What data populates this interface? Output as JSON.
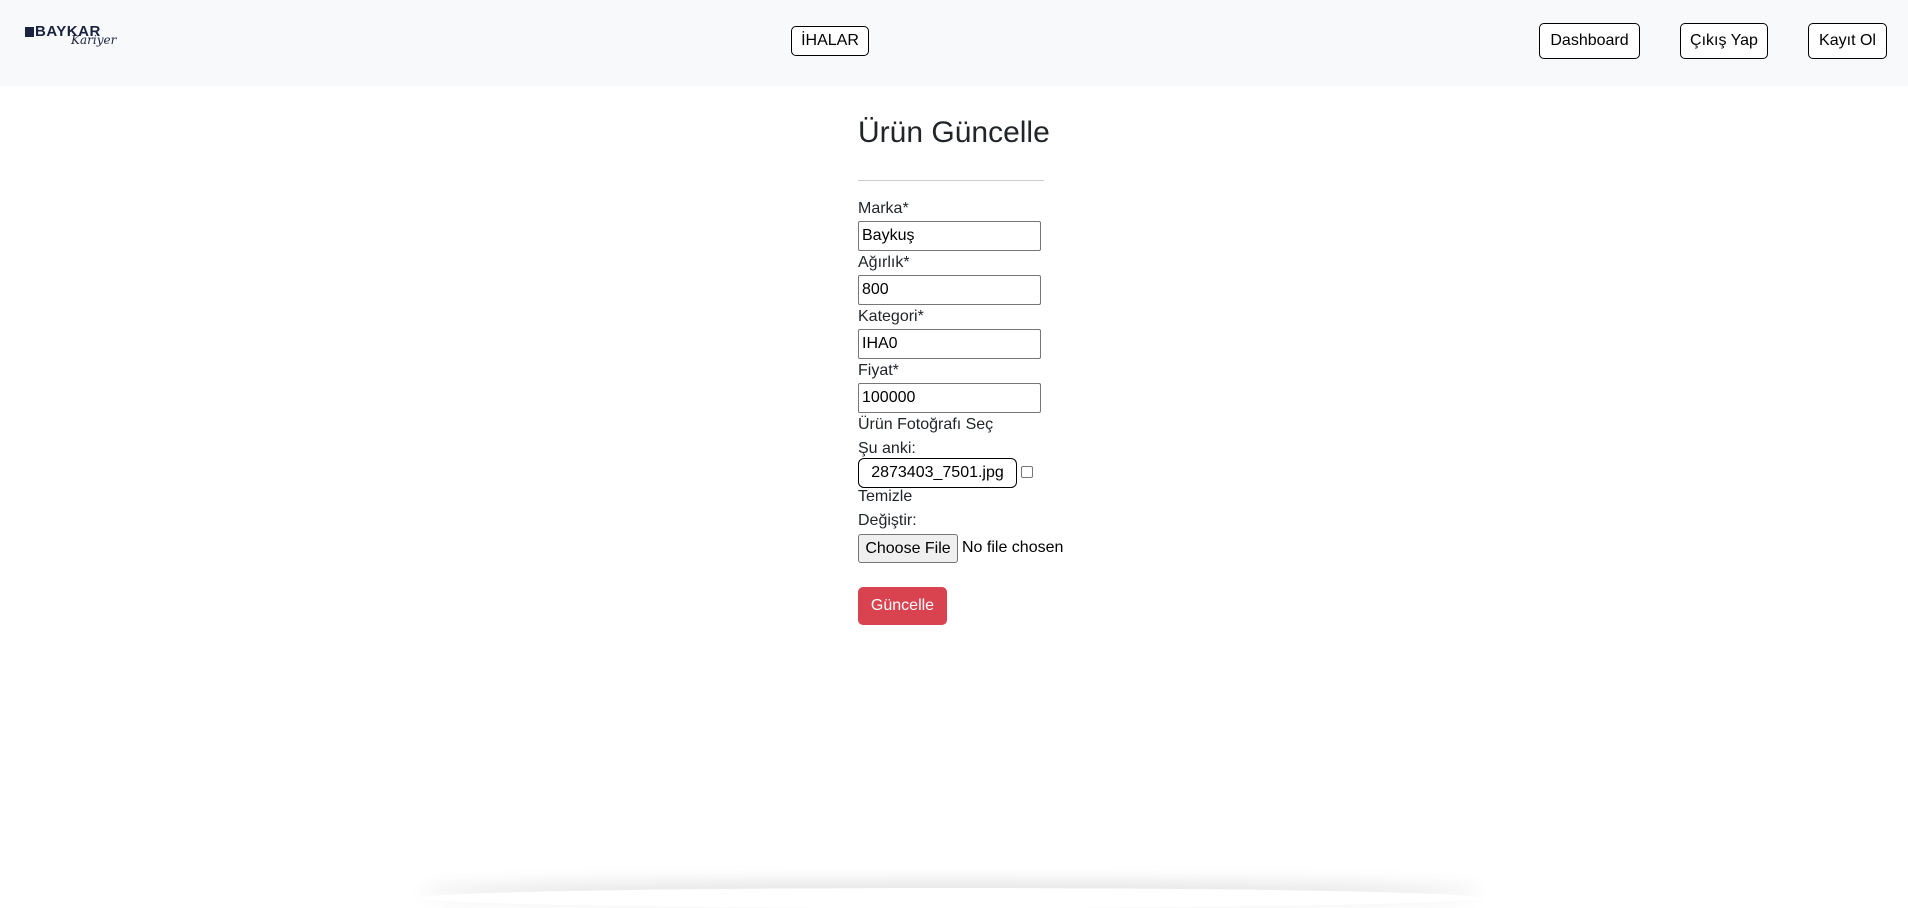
{
  "navbar": {
    "logo": {
      "text": "BAYKAR",
      "script": "Kariyer"
    },
    "center_link": "İHALAR",
    "buttons": {
      "dashboard": "Dashboard",
      "logout": "Çıkış Yap",
      "register": "Kayıt Ol"
    }
  },
  "form": {
    "title": "Ürün Güncelle",
    "fields": {
      "brand": {
        "label": "Marka*",
        "value": "Baykuş"
      },
      "weight": {
        "label": "Ağırlık*",
        "value": "800"
      },
      "category": {
        "label": "Kategori*",
        "value": "IHA0"
      },
      "price": {
        "label": "Fiyat*",
        "value": "100000"
      }
    },
    "photo": {
      "label": "Ürün Fotoğrafı Seç",
      "current_label": "Şu anki:",
      "current_file": "2873403_7501.jpg",
      "clear_label": "Temizle",
      "change_label": "Değiştir:",
      "choose_button": "Choose File",
      "no_file": "No file chosen"
    },
    "submit": "Güncelle"
  },
  "colors": {
    "navbar_bg": "#f8f9fa",
    "submit_bg": "#d9434f",
    "logo": "#1a2340"
  }
}
